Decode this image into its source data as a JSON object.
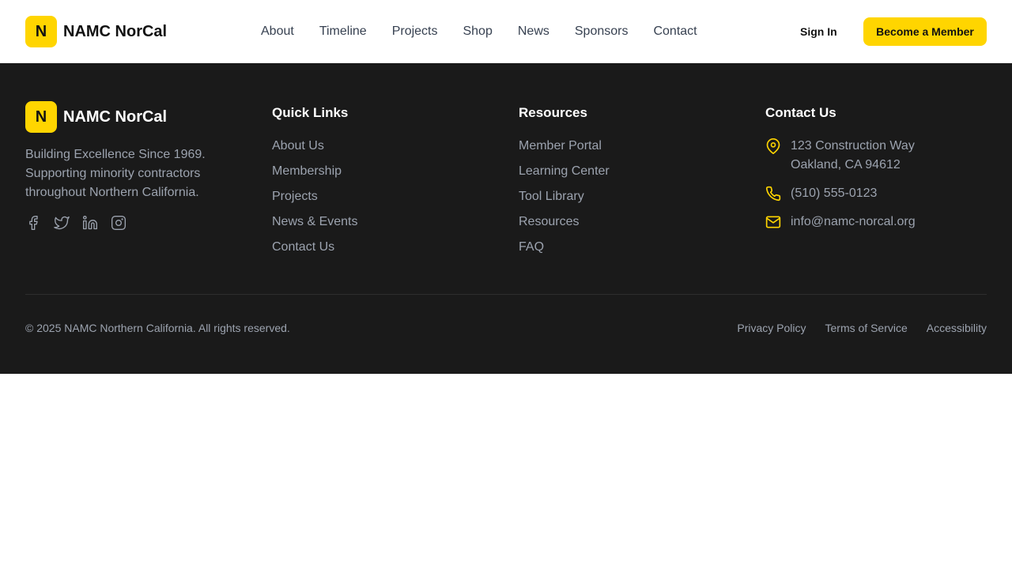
{
  "brand": {
    "logo_letter": "N",
    "name": "NAMC NorCal",
    "accent": "#FFD500"
  },
  "nav": {
    "items": [
      "About",
      "Timeline",
      "Projects",
      "Shop",
      "News",
      "Sponsors",
      "Contact"
    ],
    "sign_in": "Sign In",
    "cta": "Become a Member"
  },
  "footer": {
    "brand_name": "NAMC NorCal",
    "logo_letter": "N",
    "tagline": "Building Excellence Since 1969. Supporting minority contractors throughout Northern California.",
    "socials": [
      "facebook-icon",
      "twitter-icon",
      "linkedin-icon",
      "instagram-icon"
    ],
    "quick_links": {
      "title": "Quick Links",
      "items": [
        "About Us",
        "Membership",
        "Projects",
        "News & Events",
        "Contact Us"
      ]
    },
    "resources": {
      "title": "Resources",
      "items": [
        "Member Portal",
        "Learning Center",
        "Tool Library",
        "Resources",
        "FAQ"
      ]
    },
    "contact": {
      "title": "Contact Us",
      "address_line1": "123 Construction Way",
      "address_line2": "Oakland, CA 94612",
      "phone": "(510) 555-0123",
      "email": "info@namc-norcal.org"
    },
    "copyright": "© 2025 NAMC Northern California. All rights reserved.",
    "legal": [
      "Privacy Policy",
      "Terms of Service",
      "Accessibility"
    ],
    "background": "#1a1a1a"
  }
}
